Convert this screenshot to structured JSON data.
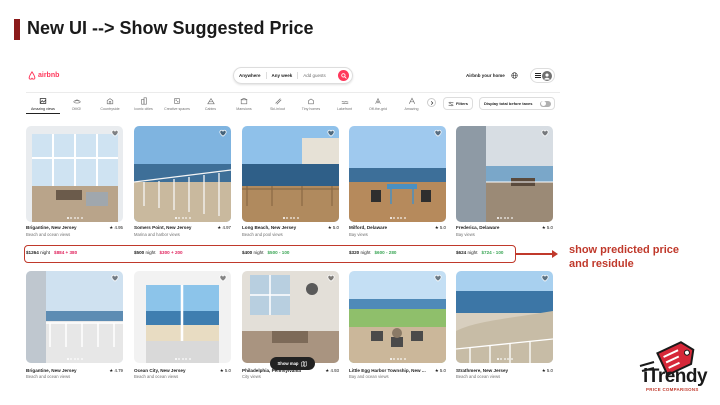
{
  "slide": {
    "title": "New UI --> Show Suggested Price",
    "annotation_line1": "show predicted price",
    "annotation_line2": "and residule",
    "accent_color": "#8b1a1a",
    "highlight_color": "#c0392b"
  },
  "brand": {
    "name": "iTrendy",
    "tagline": "PRICE COMPARISONS",
    "icon": "price-tag-icon"
  },
  "app": {
    "logo_text": "airbnb",
    "brand_color": "#ff385c",
    "search": {
      "where": "Anywhere",
      "when": "Any week",
      "guests_placeholder": "Add guests"
    },
    "host_link": "Airbnb your home",
    "categories": [
      {
        "label": "Amazing views",
        "icon": "mountain-view-icon",
        "active": true
      },
      {
        "label": "OMG!",
        "icon": "ufo-icon",
        "active": false
      },
      {
        "label": "Countryside",
        "icon": "barn-icon",
        "active": false
      },
      {
        "label": "Iconic cities",
        "icon": "city-icon",
        "active": false
      },
      {
        "label": "Creative spaces",
        "icon": "palette-icon",
        "active": false
      },
      {
        "label": "Cabins",
        "icon": "cabin-icon",
        "active": false
      },
      {
        "label": "Mansions",
        "icon": "mansion-icon",
        "active": false
      },
      {
        "label": "Ski-in/out",
        "icon": "ski-icon",
        "active": false
      },
      {
        "label": "Tiny homes",
        "icon": "tiny-home-icon",
        "active": false
      },
      {
        "label": "Lakefront",
        "icon": "lake-icon",
        "active": false
      },
      {
        "label": "Off-the-grid",
        "icon": "off-grid-icon",
        "active": false
      },
      {
        "label": "Amazing",
        "icon": "a-frame-icon",
        "active": false
      }
    ],
    "filters_label": "Filters",
    "total_label": "Display total before taxes",
    "show_map_label": "Show map",
    "listings_row1": [
      {
        "location": "Brigantine, New Jersey",
        "rating": "4.95",
        "desc": "Beach and ocean views",
        "price": "$1264",
        "price_suffix": "night",
        "predicted": "$884 + 380",
        "pred_color": "#e0245e"
      },
      {
        "location": "Somers Point, New Jersey",
        "rating": "4.97",
        "desc": "Marina and harbor views",
        "price": "$500",
        "price_suffix": "night",
        "predicted": "$300 + 200",
        "pred_color": "#e0245e"
      },
      {
        "location": "Long Beach, New Jersey",
        "rating": "5.0",
        "desc": "Beach and pool views",
        "price": "$400",
        "price_suffix": "night",
        "predicted": "$500 - 100",
        "pred_color": "#3aa655"
      },
      {
        "location": "Milford, Delaware",
        "rating": "5.0",
        "desc": "Bay views",
        "price": "$320",
        "price_suffix": "night",
        "predicted": "$600 - 280",
        "pred_color": "#3aa655"
      },
      {
        "location": "Frederica, Delaware",
        "rating": "5.0",
        "desc": "Bay views",
        "price": "$624",
        "price_suffix": "night",
        "predicted": "$724 - 100",
        "pred_color": "#3aa655"
      }
    ],
    "listings_row2": [
      {
        "location": "Brigantine, New Jersey",
        "rating": "4.79",
        "desc": "Beach and ocean views"
      },
      {
        "location": "Ocean City, New Jersey",
        "rating": "5.0",
        "desc": "Beach and ocean views"
      },
      {
        "location": "Philadelphia, Pennsylvania",
        "rating": "4.93",
        "desc": "City views"
      },
      {
        "location": "Little Egg Harbor Township, New ...",
        "rating": "5.0",
        "desc": "Bay and ocean views"
      },
      {
        "location": "Strathmere, New Jersey",
        "rating": "5.0",
        "desc": "Beach and ocean views"
      }
    ]
  }
}
